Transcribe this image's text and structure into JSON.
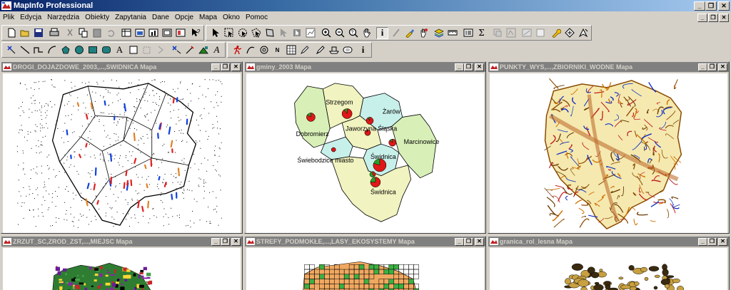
{
  "app": {
    "title": "MapInfo Professional"
  },
  "menu": [
    "Plik",
    "Edycja",
    "Narzędzia",
    "Obiekty",
    "Zapytania",
    "Dane",
    "Opcje",
    "Mapa",
    "Okno",
    "Pomoc"
  ],
  "window_controls": {
    "minimize": "_",
    "restore": "❐",
    "close": "✕"
  },
  "toolbar_text": {
    "info": "i",
    "sigma": "Σ",
    "text_tool": "A",
    "label_tool": "A",
    "north": "N",
    "info2": "i"
  },
  "windows": [
    {
      "title": "DROGI_DOJAZDOWE_2003,...,SWIDNICA Mapa"
    },
    {
      "title": "gminy_2003 Mapa"
    },
    {
      "title": "PUNKTY_WYS,...,ZBIORNIKI_WODNE Mapa"
    },
    {
      "title": "ZRZUT_SC,ZROD_ZST,...,MIEJSC Mapa"
    },
    {
      "title": "STREFY_PODMOKŁE,...,LASY_EKOSYSTEMY Mapa"
    },
    {
      "title": "granica_rol_lesna Mapa"
    }
  ],
  "gminy_labels": {
    "strzegom": "Strzegom",
    "zarow": "Żarów",
    "dobromierz": "Dobromierz",
    "jaworzyna": "Jaworzyna Śląska",
    "marcinowice": "Marcinowice",
    "swiebodzice": "Świebodzice miasto",
    "swidnica_miasto": "Świdnica",
    "swidnica": "Świdnica"
  },
  "colors": {
    "title_bar": "#0a246a",
    "face": "#d4d0c8",
    "gmina_yellow": "#f1f3c0",
    "gmina_cyan": "#c8f0ea",
    "gmina_green": "#d8f0b8",
    "pie_red": "#e01818",
    "pie_green": "#28a028"
  }
}
